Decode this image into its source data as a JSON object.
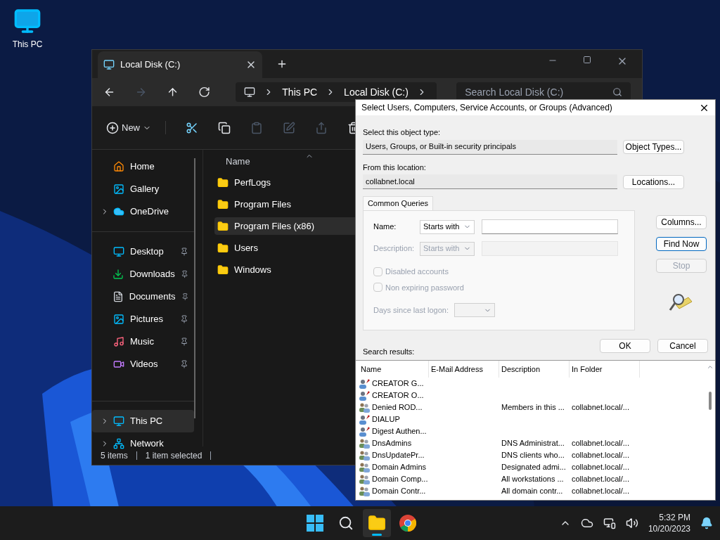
{
  "desktop_icons": [
    {
      "label": "This PC"
    }
  ],
  "explorer": {
    "tab": {
      "title": "Local Disk (C:)"
    },
    "nav_buttons": [
      {
        "disabled": false
      },
      {
        "disabled": true
      },
      {
        "disabled": false
      },
      {
        "disabled": false
      }
    ],
    "breadcrumb": [
      "This PC",
      "Local Disk (C:)"
    ],
    "search": {
      "placeholder": "Search Local Disk (C:)"
    },
    "toolbar": [
      {
        "kind": "new",
        "label": "New",
        "disabled": false
      },
      {
        "kind": "cut",
        "disabled": false
      },
      {
        "kind": "copy",
        "disabled": false
      },
      {
        "kind": "paste",
        "disabled": true
      },
      {
        "kind": "rename",
        "disabled": true
      },
      {
        "kind": "share",
        "disabled": true
      },
      {
        "kind": "delete",
        "disabled": false
      }
    ],
    "sidebar": {
      "groups": [
        [
          {
            "label": "Home",
            "expandable": false,
            "pinned": false,
            "selected": false
          },
          {
            "label": "Gallery",
            "expandable": false,
            "pinned": false,
            "selected": false
          },
          {
            "label": "OneDrive",
            "expandable": true,
            "pinned": false,
            "selected": false
          }
        ],
        [
          {
            "label": "Desktop",
            "expandable": false,
            "pinned": true,
            "selected": false
          },
          {
            "label": "Downloads",
            "expandable": false,
            "pinned": true,
            "selected": false
          },
          {
            "label": "Documents",
            "expandable": false,
            "pinned": true,
            "selected": false
          },
          {
            "label": "Pictures",
            "expandable": false,
            "pinned": true,
            "selected": false
          },
          {
            "label": "Music",
            "expandable": false,
            "pinned": true,
            "selected": false
          },
          {
            "label": "Videos",
            "expandable": false,
            "pinned": true,
            "selected": false
          }
        ],
        [
          {
            "label": "This PC",
            "expandable": true,
            "pinned": false,
            "selected": true
          },
          {
            "label": "Network",
            "expandable": true,
            "pinned": false,
            "selected": false
          }
        ]
      ]
    },
    "columns": [
      "Name"
    ],
    "files": [
      {
        "name": "PerfLogs",
        "selected": false
      },
      {
        "name": "Program Files",
        "selected": false
      },
      {
        "name": "Program Files (x86)",
        "selected": true
      },
      {
        "name": "Users",
        "selected": false
      },
      {
        "name": "Windows",
        "selected": false
      }
    ],
    "status_bar": [
      "5 items",
      "1 item selected"
    ]
  },
  "dialog": {
    "title": "Select Users, Computers, Service Accounts, or Groups (Advanced)",
    "object_type": {
      "label": "Select this object type:",
      "value": "Users, Groups, or Built-in security principals",
      "button": "Object Types..."
    },
    "location": {
      "label": "From this location:",
      "value": "collabnet.local",
      "button": "Locations..."
    },
    "query_tab": {
      "label": "Common Queries",
      "selected": true
    },
    "name_row": {
      "label": "Name:",
      "mode": "Starts with",
      "disabled": false
    },
    "description_row": {
      "label": "Description:",
      "mode": "Starts with",
      "disabled": true
    },
    "checkboxes": [
      {
        "label": "Disabled accounts",
        "checked": false,
        "disabled": true
      },
      {
        "label": "Non expiring password",
        "checked": false,
        "disabled": true
      }
    ],
    "days_since_logon": {
      "label": "Days since last logon:",
      "disabled": true
    },
    "side_buttons": [
      {
        "label": "Columns...",
        "disabled": false,
        "default": false
      },
      {
        "label": "Find Now",
        "disabled": false,
        "default": true
      },
      {
        "label": "Stop",
        "disabled": true,
        "default": false
      }
    ],
    "buttons": [
      "OK",
      "Cancel"
    ],
    "results_label": "Search results:",
    "results_columns": [
      "Name",
      "E-Mail Address",
      "Description",
      "In Folder"
    ],
    "results": [
      {
        "kind": "principal",
        "name": "CREATOR G..."
      },
      {
        "kind": "principal",
        "name": "CREATOR O..."
      },
      {
        "kind": "group",
        "name": "Denied ROD...",
        "description": "Members in this ...",
        "folder": "collabnet.local/..."
      },
      {
        "kind": "principal",
        "name": "DIALUP"
      },
      {
        "kind": "principal",
        "name": "Digest Authen..."
      },
      {
        "kind": "group",
        "name": "DnsAdmins",
        "description": "DNS Administrat...",
        "folder": "collabnet.local/..."
      },
      {
        "kind": "group",
        "name": "DnsUpdatePr...",
        "description": "DNS clients who...",
        "folder": "collabnet.local/..."
      },
      {
        "kind": "group",
        "name": "Domain Admins",
        "description": "Designated admi...",
        "folder": "collabnet.local/..."
      },
      {
        "kind": "group",
        "name": "Domain Comp...",
        "description": "All workstations ...",
        "folder": "collabnet.local/..."
      },
      {
        "kind": "group",
        "name": "Domain Contr...",
        "description": "All domain contr...",
        "folder": "collabnet.local/..."
      }
    ]
  },
  "taskbar": {
    "apps": [
      {
        "kind": "start",
        "selected": false
      },
      {
        "kind": "search",
        "selected": false
      },
      {
        "kind": "explorer",
        "selected": true
      },
      {
        "kind": "chrome",
        "selected": false
      }
    ],
    "time": "5:32 PM",
    "date": "10/20/2023"
  }
}
